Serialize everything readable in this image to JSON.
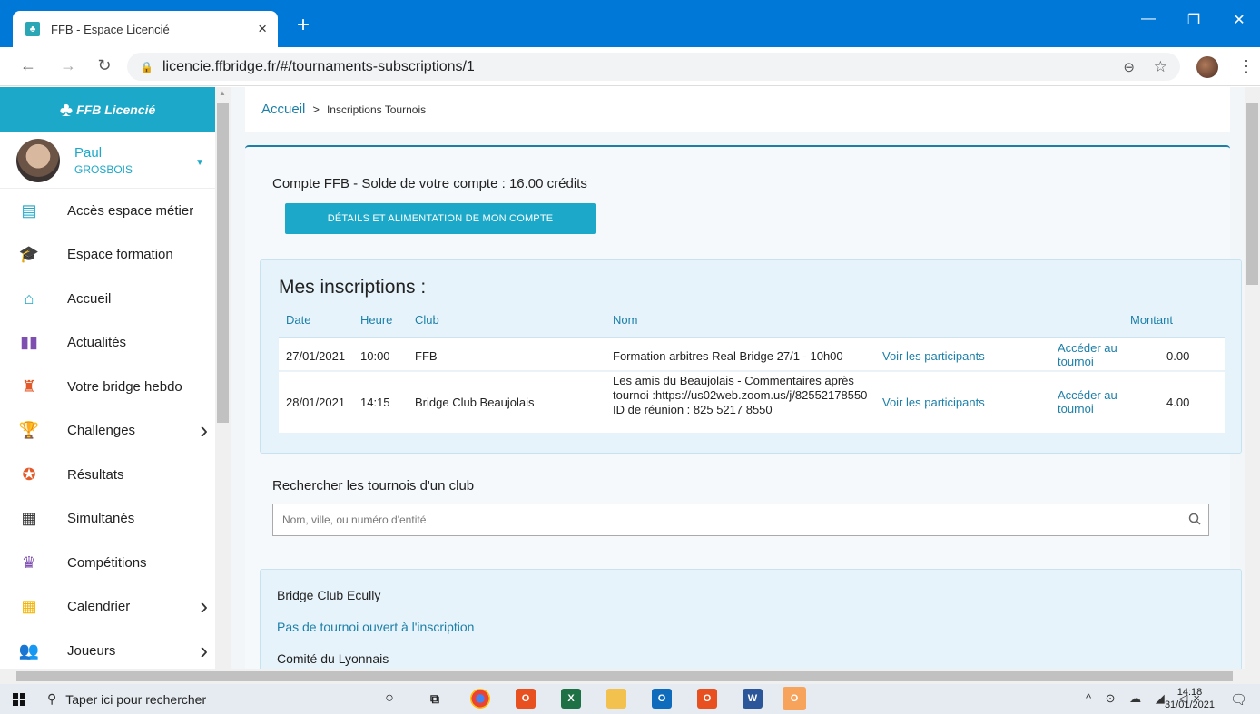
{
  "browser": {
    "tab_title": "FFB - Espace Licencié",
    "tab_close": "×",
    "new_tab": "+",
    "url": "licencie.ffbridge.fr/#/tournaments-subscriptions/1",
    "window_controls": [
      "—",
      "❐",
      "✕"
    ]
  },
  "sidebar": {
    "brand": "FFB Licencié",
    "user_first": "Paul",
    "user_last": "GROSBOIS",
    "items": [
      {
        "label": "Accès espace métier",
        "icon": "building-icon",
        "color": "#1ca8c8",
        "glyph": "▤",
        "chevron": false
      },
      {
        "label": "Espace formation",
        "icon": "graduate-icon",
        "color": "#7e4fb0",
        "glyph": "🎓",
        "chevron": false
      },
      {
        "label": "Accueil",
        "icon": "home-icon",
        "color": "#1ca8c8",
        "glyph": "⌂",
        "chevron": false
      },
      {
        "label": "Actualités",
        "icon": "book-icon",
        "color": "#7e4fb0",
        "glyph": "▮▮",
        "chevron": false
      },
      {
        "label": "Votre bridge hebdo",
        "icon": "person-icon",
        "color": "#e35a2a",
        "glyph": "♜",
        "chevron": false
      },
      {
        "label": "Challenges",
        "icon": "trophy-icon",
        "color": "#f2b400",
        "glyph": "🏆",
        "chevron": true
      },
      {
        "label": "Résultats",
        "icon": "medal-icon",
        "color": "#e35a2a",
        "glyph": "✪",
        "chevron": false
      },
      {
        "label": "Simultanés",
        "icon": "grid-icon",
        "color": "#333333",
        "glyph": "▦",
        "chevron": false
      },
      {
        "label": "Compétitions",
        "icon": "cup-icon",
        "color": "#7e4fb0",
        "glyph": "♛",
        "chevron": false
      },
      {
        "label": "Calendrier",
        "icon": "calendar-icon",
        "color": "#f2b400",
        "glyph": "▦",
        "chevron": true
      },
      {
        "label": "Joueurs",
        "icon": "users-icon",
        "color": "#333333",
        "glyph": "👥",
        "chevron": true
      }
    ]
  },
  "breadcrumb": {
    "home": "Accueil",
    "separator": ">",
    "current": "Inscriptions Tournois"
  },
  "account": {
    "balance_text": "Compte FFB - Solde de votre compte : 16.00 crédits",
    "details_button": "DÉTAILS ET ALIMENTATION DE MON COMPTE"
  },
  "inscriptions": {
    "title": "Mes inscriptions :",
    "headers": {
      "date": "Date",
      "heure": "Heure",
      "club": "Club",
      "nom": "Nom",
      "montant": "Montant"
    },
    "rows": [
      {
        "date": "27/01/2021",
        "heure": "10:00",
        "club": "FFB",
        "nom": "Formation arbitres Real Bridge 27/1 - 10h00",
        "participants": "Voir les participants",
        "acceder": "Accéder au tournoi",
        "montant": "0.00"
      },
      {
        "date": "28/01/2021",
        "heure": "14:15",
        "club": "Bridge Club Beaujolais",
        "nom": "Les amis du Beaujolais - Commentaires après tournoi :https://us02web.zoom.us/j/82552178550 ID de réunion : 825 5217 8550",
        "participants": "Voir les participants",
        "acceder": "Accéder au tournoi",
        "montant": "4.00"
      }
    ]
  },
  "search": {
    "title": "Rechercher les tournois d'un club",
    "placeholder": "Nom, ville, ou numéro d'entité"
  },
  "clubs": [
    {
      "name": "Bridge Club Ecully",
      "status": "Pas de tournoi ouvert à l'inscription"
    },
    {
      "name": "Comité du Lyonnais",
      "status": ""
    }
  ],
  "taskbar": {
    "search_text": "Taper ici pour rechercher",
    "time": "14:18",
    "date": "31/01/2021"
  },
  "colors": {
    "accent": "#1ca8c8",
    "link": "#1c7fa8",
    "titlebar": "#0078d7"
  }
}
